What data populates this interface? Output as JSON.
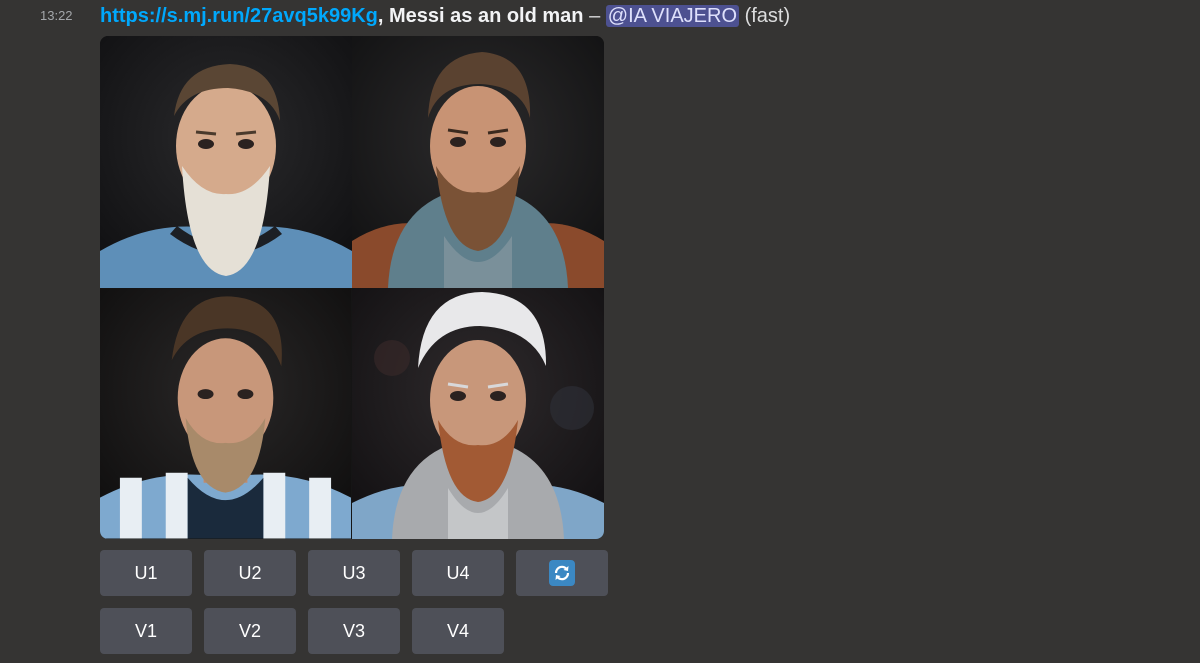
{
  "message": {
    "timestamp": "13:22",
    "link": "https://s.mj.run/27avq5k99Kg",
    "separator_comma": ",",
    "prompt": "Messi as an old man",
    "dash": "–",
    "mention": "@IA VIAJERO",
    "mode": "(fast)"
  },
  "image_grid": {
    "tiles": [
      {
        "icon": "portrait-old-man-white-beard-jersey"
      },
      {
        "icon": "portrait-bearded-man-hoodie-plaid"
      },
      {
        "icon": "portrait-man-striped-jersey"
      },
      {
        "icon": "portrait-white-hair-grey-hoodie"
      }
    ]
  },
  "buttons": {
    "upscale": [
      "U1",
      "U2",
      "U3",
      "U4"
    ],
    "variation": [
      "V1",
      "V2",
      "V3",
      "V4"
    ],
    "reroll_icon": "refresh-icon"
  },
  "colors": {
    "background": "#353433",
    "link": "#00a8fc",
    "mention_bg": "#4d5191",
    "button_bg": "#4e5058",
    "reroll_icon_bg": "#3b88c3"
  }
}
